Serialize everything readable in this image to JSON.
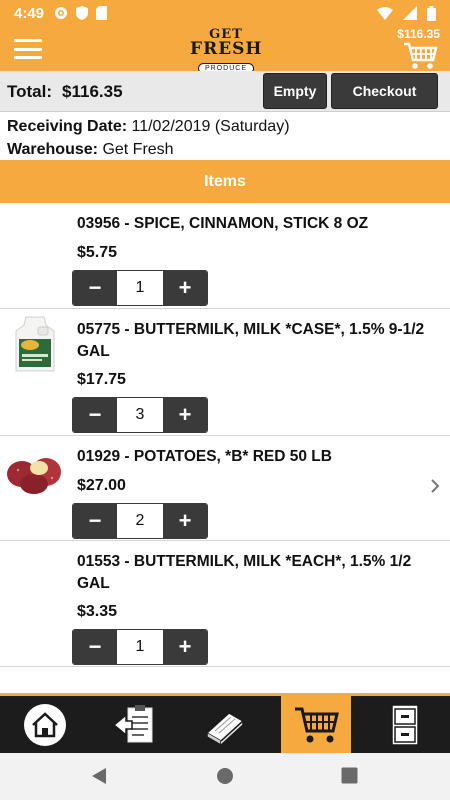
{
  "status": {
    "time": "4:49"
  },
  "app": {
    "logo_line1": "GET",
    "logo_line2": "FRESH",
    "logo_line3": "PRODUCE",
    "cart_total": "$116.35"
  },
  "summary": {
    "total_label": "Total:",
    "total_value": "$116.35",
    "empty_label": "Empty",
    "checkout_label": "Checkout",
    "receiving_label": "Receiving Date:",
    "receiving_value": "11/02/2019 (Saturday)",
    "warehouse_label": "Warehouse:",
    "warehouse_value": "Get Fresh"
  },
  "items_header": "Items",
  "items": [
    {
      "name": "03956 - SPICE, CINNAMON, STICK 8 OZ",
      "price": "$5.75",
      "qty": "1",
      "image": "none"
    },
    {
      "name": "05775 - BUTTERMILK, MILK *CASE*, 1.5% 9-1/2 GAL",
      "price": "$17.75",
      "qty": "3",
      "image": "milk-jug"
    },
    {
      "name": "01929 - POTATOES, *B* RED 50 LB",
      "price": "$27.00",
      "qty": "2",
      "image": "red-potatoes"
    },
    {
      "name": "01553 - BUTTERMILK, MILK *EACH*, 1.5% 1/2 GAL",
      "price": "$3.35",
      "qty": "1",
      "image": "none"
    }
  ],
  "stepper": {
    "minus": "−",
    "plus": "+"
  },
  "bottom_nav": [
    {
      "name": "home",
      "icon": "home-icon",
      "active": false
    },
    {
      "name": "orders",
      "icon": "clipboard-arrow-icon",
      "active": false
    },
    {
      "name": "catalog",
      "icon": "book-icon",
      "active": false
    },
    {
      "name": "cart",
      "icon": "cart-icon",
      "active": true
    },
    {
      "name": "account",
      "icon": "cabinet-icon",
      "active": false
    }
  ],
  "colors": {
    "accent": "#f5a93f",
    "dark": "#3a3a3a"
  }
}
